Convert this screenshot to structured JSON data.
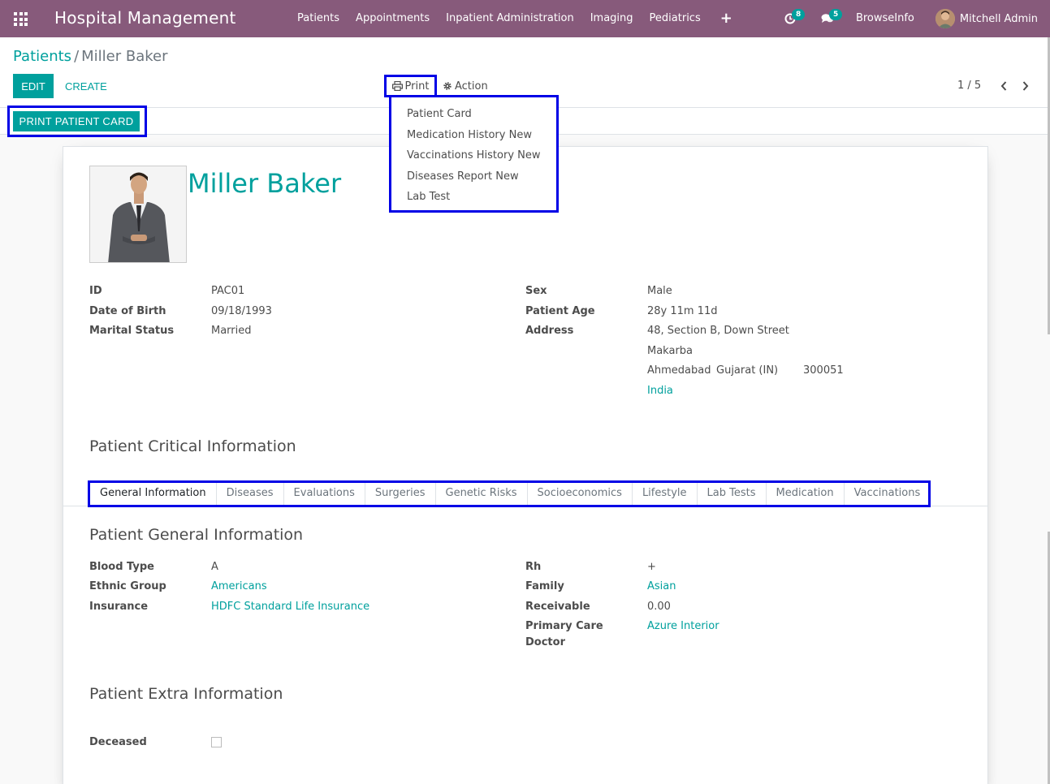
{
  "navbar": {
    "app_title": "Hospital Management",
    "menu": [
      "Patients",
      "Appointments",
      "Inpatient Administration",
      "Imaging",
      "Pediatrics"
    ],
    "plus": "+",
    "activity_count": "8",
    "messages_count": "5",
    "browseinfo": "BrowseInfo",
    "user_name": "Mitchell Admin"
  },
  "breadcrumb": {
    "parent": "Patients",
    "separator": "/",
    "current": "Miller Baker"
  },
  "toolbar": {
    "edit": "EDIT",
    "create": "CREATE",
    "print": "Print",
    "action": "Action",
    "pager": "1 / 5"
  },
  "statusbar": {
    "print_patient_card": "PRINT PATIENT CARD"
  },
  "print_menu": [
    "Patient Card",
    "Medication History New",
    "Vaccinations History New",
    "Diseases Report New",
    "Lab Test"
  ],
  "patient": {
    "name": "Miller Baker",
    "left_fields": [
      {
        "label": "ID",
        "value": "PAC01"
      },
      {
        "label": "Date of Birth",
        "value": "09/18/1993"
      },
      {
        "label": "Marital Status",
        "value": "Married"
      }
    ],
    "sex_label": "Sex",
    "sex": "Male",
    "age_label": "Patient Age",
    "age": "28y 11m 11d",
    "address_label": "Address",
    "address_line1": "48, Section B, Down Street",
    "address_line2": "Makarba",
    "city": "Ahmedabad",
    "state": "Gujarat (IN)",
    "zip": "300051",
    "country": "India"
  },
  "critical_title": "Patient Critical Information",
  "tabs": [
    "General Information",
    "Diseases",
    "Evaluations",
    "Surgeries",
    "Genetic Risks",
    "Socioeconomics",
    "Lifestyle",
    "Lab Tests",
    "Medication",
    "Vaccinations"
  ],
  "general": {
    "title": "Patient General Information",
    "blood_type_label": "Blood Type",
    "blood_type": "A",
    "ethnic_label": "Ethnic Group",
    "ethnic": "Americans",
    "insurance_label": "Insurance",
    "insurance": "HDFC Standard Life Insurance",
    "rh_label": "Rh",
    "rh": "+",
    "family_label": "Family",
    "family": "Asian",
    "receivable_label": "Receivable",
    "receivable": "0.00",
    "pcd_label_1": "Primary Care",
    "pcd_label_2": "Doctor",
    "pcd": "Azure Interior"
  },
  "extra": {
    "title": "Patient Extra Information",
    "deceased_label": "Deceased",
    "deceased": false
  },
  "colors": {
    "navbar": "#875a7b",
    "primary": "#00a09d",
    "highlight": "#0000e6"
  }
}
